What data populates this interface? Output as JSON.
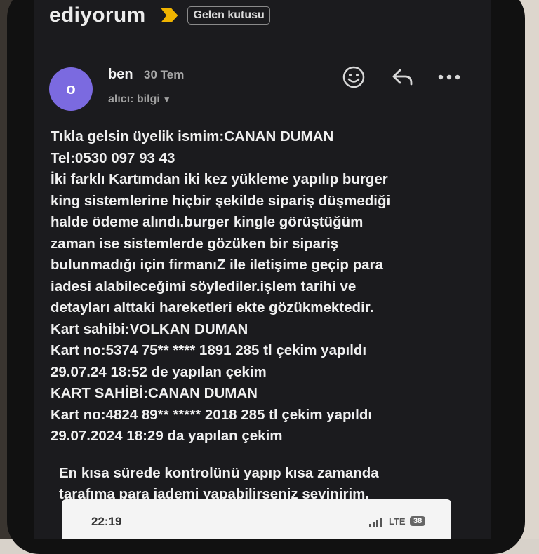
{
  "header": {
    "subject": "ediyorum",
    "label": "Gelen kutusu"
  },
  "message": {
    "avatar_letter": "o",
    "sender": "ben",
    "date": "30 Tem",
    "recipient": "alıcı: bilgi",
    "actions": [
      "emoji-reaction",
      "reply",
      "more-options"
    ]
  },
  "body": {
    "lines": [
      "Tıkla gelsin üyelik ismim:CANAN DUMAN",
      "Tel:0530 097 93 43",
      "İki farklı Kartımdan iki kez yükleme yapılıp burger",
      "king sistemlerine hiçbir şekilde sipariş düşmediği",
      "halde ödeme alındı.burger kingle görüştüğüm",
      "zaman ise sistemlerde gözüken bir sipariş",
      "bulunmadığı için firmanıZ ile iletişime geçip para",
      "iadesi alabileceğimi söylediler.işlem tarihi ve",
      "detayları alttaki hareketleri ekte gözükmektedir.",
      "Kart sahibi:VOLKAN DUMAN",
      "Kart no:5374 75** **** 1891 285 tl çekim yapıldı",
      "29.07.24 18:52 de yapılan çekim",
      "KART SAHİBİ:CANAN DUMAN",
      "Kart no:4824 89** ***** 2018 285 tl çekim yapıldı",
      "29.07.2024 18:29 da yapılan çekim"
    ],
    "closing": [
      "En kısa sürede kontrolünü yapıp kısa  zamanda",
      "tarafıma para iademi yapabilirseniz sevinirim."
    ]
  },
  "notification": {
    "time": "22:19",
    "network": "LTE",
    "battery": "38"
  },
  "colors": {
    "background": "#1b1b1e",
    "avatar": "#7b6ae0",
    "importance_marker": "#f0b400"
  }
}
